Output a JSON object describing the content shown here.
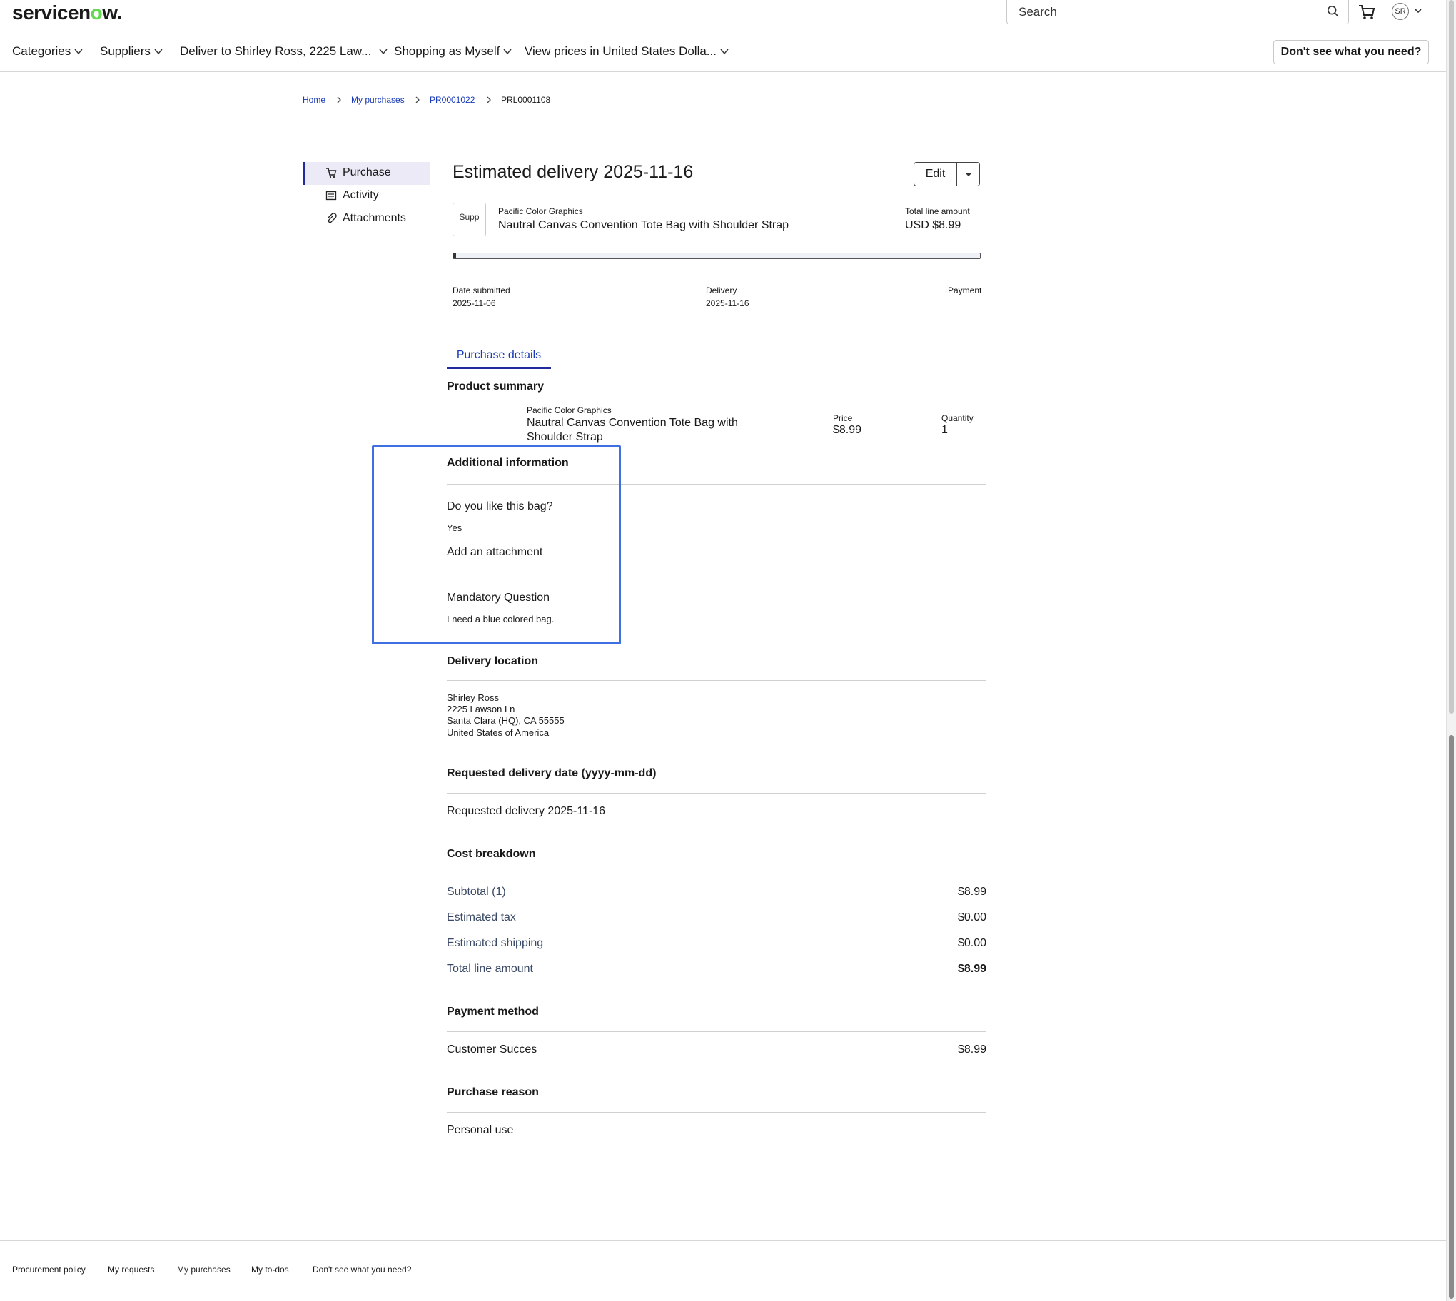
{
  "header": {
    "logo_text": "servicen",
    "logo_o": "o",
    "logo_rest": "w.",
    "search_placeholder": "Search",
    "avatar_initials": "SR"
  },
  "nav": {
    "categories": "Categories",
    "suppliers": "Suppliers",
    "deliver_to": "Deliver to Shirley Ross, 2225 Law...",
    "shopping_as": "Shopping as Myself",
    "view_prices": "View prices in United States Dolla...",
    "dont_see": "Don't see what you need?"
  },
  "breadcrumb": {
    "home": "Home",
    "my_purchases": "My purchases",
    "pr": "PR0001022",
    "prl": "PRL0001108"
  },
  "sidenav": {
    "purchase": "Purchase",
    "activity": "Activity",
    "attachments": "Attachments"
  },
  "order": {
    "title": "Estimated delivery 2025-11-16",
    "edit": "Edit",
    "thumb_alt": "Supp",
    "supplier": "Pacific Color Graphics",
    "product": "Nautral Canvas Convention Tote Bag with Shoulder Strap",
    "total_label": "Total line amount",
    "total_value": "USD $8.99",
    "progress_fraction": 0.005,
    "date_submitted_label": "Date submitted",
    "date_submitted": "2025-11-06",
    "delivery_label": "Delivery",
    "delivery_date": "2025-11-16",
    "payment_label": "Payment"
  },
  "tabs": {
    "purchase_details": "Purchase details"
  },
  "product_summary": {
    "heading": "Product summary",
    "supplier": "Pacific Color Graphics",
    "name_line1": "Nautral Canvas Convention Tote Bag with",
    "name_line2": "Shoulder Strap",
    "price_label": "Price",
    "price": "$8.99",
    "qty_label": "Quantity",
    "qty": "1"
  },
  "additional_info": {
    "heading": "Additional information",
    "q1": "Do you like this bag?",
    "a1": "Yes",
    "q2": "Add an attachment",
    "a2": "-",
    "q3": "Mandatory Question",
    "a3": "I need a blue colored bag."
  },
  "delivery_location": {
    "heading": "Delivery location",
    "name": "Shirley Ross",
    "street": "2225 Lawson Ln",
    "city": "Santa Clara (HQ), CA 55555",
    "country": "United States of America"
  },
  "requested_delivery": {
    "heading": "Requested delivery date (yyyy-mm-dd)",
    "value": "Requested delivery 2025-11-16"
  },
  "cost": {
    "heading": "Cost breakdown",
    "rows": [
      {
        "label": "Subtotal (1)",
        "value": "$8.99"
      },
      {
        "label": "Estimated tax",
        "value": "$0.00"
      },
      {
        "label": "Estimated shipping",
        "value": "$0.00"
      },
      {
        "label": "Total line amount",
        "value": "$8.99"
      }
    ]
  },
  "payment": {
    "heading": "Payment method",
    "label": "Customer Succes",
    "value": "$8.99"
  },
  "reason": {
    "heading": "Purchase reason",
    "value": "Personal use"
  },
  "footer": {
    "links": [
      "Procurement policy",
      "My requests",
      "My purchases",
      "My to-dos",
      "Don't see what you need?"
    ]
  },
  "colors": {
    "accent": "#1f2a9c",
    "link": "#1a3bb8",
    "highlight": "#3f6fe0",
    "logo_green": "#62d84e"
  }
}
